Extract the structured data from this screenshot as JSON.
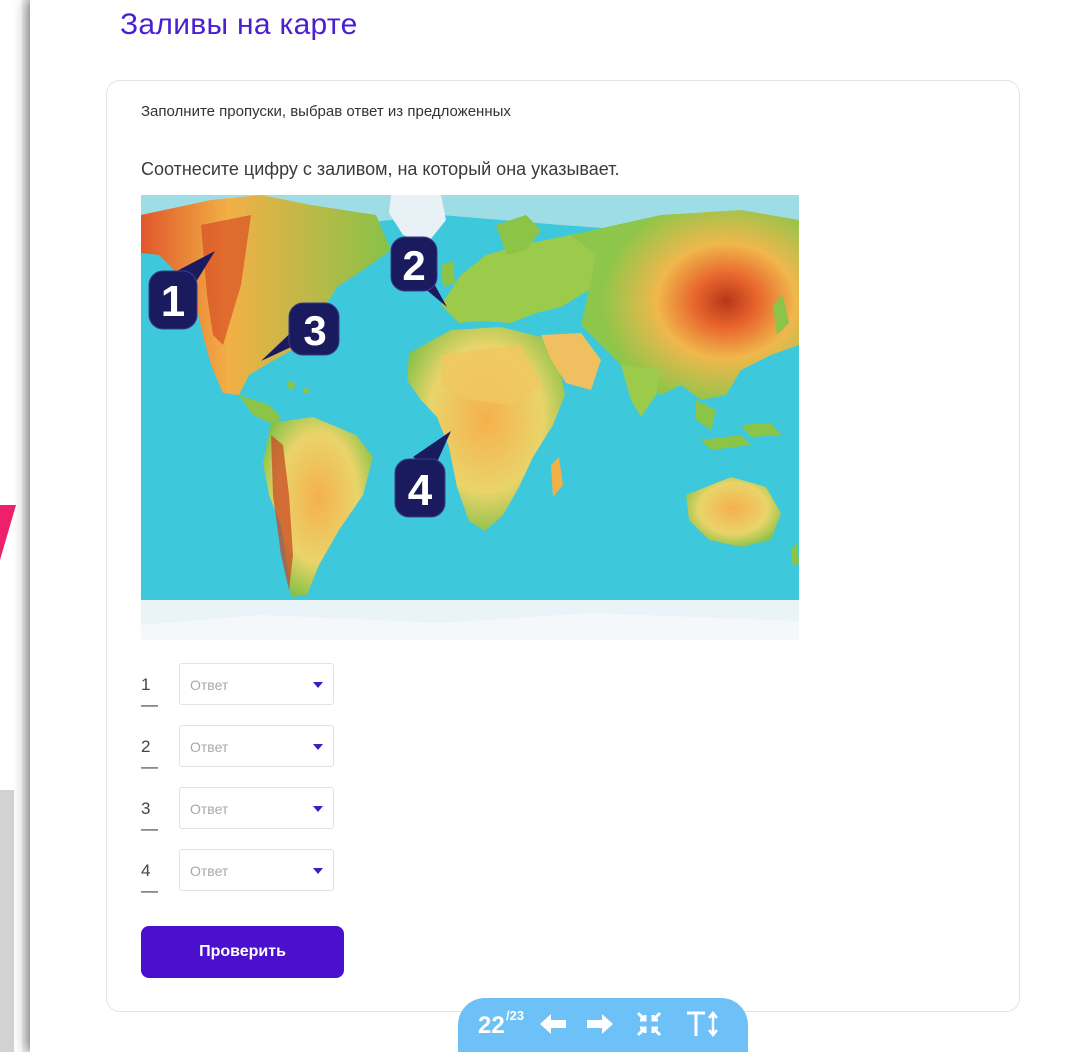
{
  "page": {
    "title": "Заливы на карте"
  },
  "task": {
    "instruction": "Заполните пропуски, выбрав ответ из предложенных",
    "question": "Соотнесите цифру с заливом, на который она указывает."
  },
  "map": {
    "markers": [
      "1",
      "2",
      "3",
      "4"
    ]
  },
  "answers": [
    {
      "num": "1 —",
      "value": "Ответ"
    },
    {
      "num": "2 —",
      "value": "Ответ"
    },
    {
      "num": "3 —",
      "value": "Ответ"
    },
    {
      "num": "4 —",
      "value": "Ответ"
    }
  ],
  "check_button": "Проверить",
  "toolbar": {
    "current_page": "22",
    "total_pages": "/23",
    "icons": [
      "arrow-left-icon",
      "arrow-right-icon",
      "collapse-icon",
      "text-size-icon"
    ]
  },
  "colors": {
    "title": "#4b1fd1",
    "button": "#4a10cc",
    "toolbar": "#6ec1f6",
    "ocean": "#3ec8dc",
    "marker": "#1a1a5e"
  }
}
